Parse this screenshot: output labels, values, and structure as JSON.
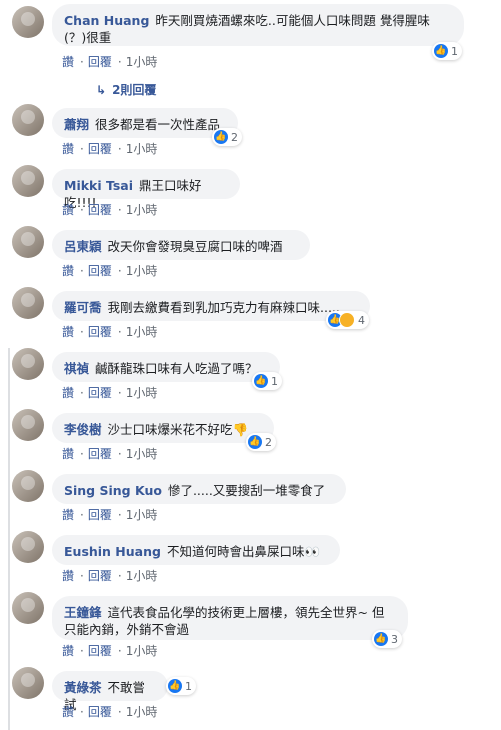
{
  "comments": [
    {
      "name": "Chan Huang",
      "text": "昨天剛買燒酒螺來吃..可能個人口味問題 覺得腥味(？)很重",
      "reactions": "1",
      "haha": false
    },
    {
      "name": "蕭翔",
      "text": "很多都是看一次性產品",
      "reactions": "2",
      "haha": false
    },
    {
      "name": "Mikki Tsai",
      "text": "鼎王口味好吃!!!!",
      "reactions": "",
      "haha": false
    },
    {
      "name": "呂東穎",
      "text": "改天你會發現臭豆腐口味的啤酒",
      "reactions": "",
      "haha": false
    },
    {
      "name": "羅可喬",
      "text": "我剛去繳費看到乳加巧克力有麻辣口味.....",
      "reactions": "4",
      "haha": true
    },
    {
      "name": "祺禎",
      "text": "鹹酥龍珠口味有人吃過了嗎？",
      "reactions": "1",
      "haha": false
    },
    {
      "name": "李俊樹",
      "text": "沙士口味爆米花不好吃👎",
      "reactions": "2",
      "haha": false
    },
    {
      "name": "Sing Sing Kuo",
      "text": "慘了.....又要搜刮一堆零食了",
      "reactions": "",
      "haha": false
    },
    {
      "name": "Eushin Huang",
      "text": "不知道何時會出鼻屎口味👀",
      "reactions": "",
      "haha": false
    },
    {
      "name": "王鐘鋒",
      "text": "這代表食品化學的技術更上層樓，領先全世界~ 但只能內銷，外銷不會過",
      "reactions": "3",
      "haha": false
    },
    {
      "name": "黃綠茶",
      "text": "不敢嘗試",
      "reactions": "1",
      "haha": false
    }
  ],
  "actions": {
    "like": "讚",
    "reply": "回覆",
    "time": "1小時",
    "dot": "·"
  },
  "replies_label": "2則回覆"
}
